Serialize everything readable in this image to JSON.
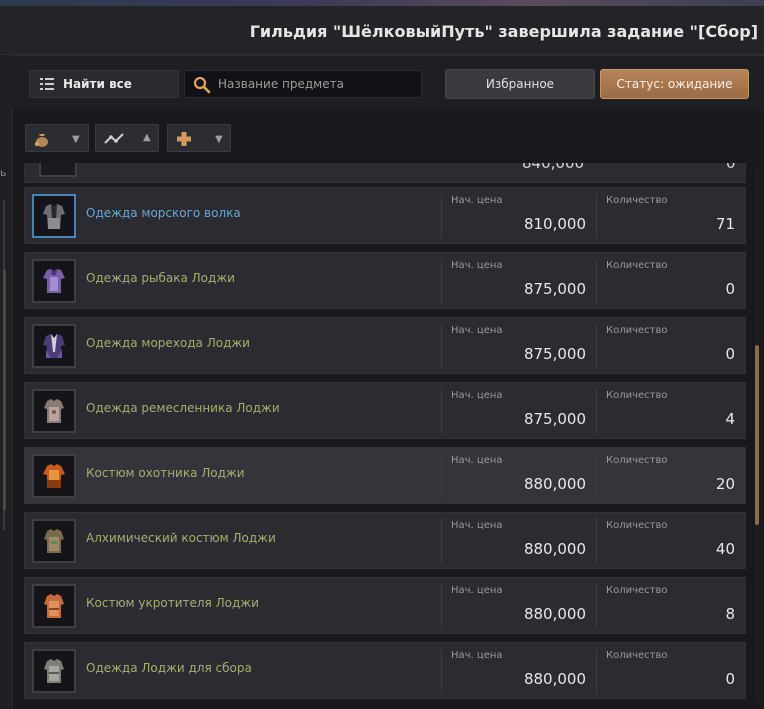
{
  "notice": {
    "text": "Гильдия \"ШёлковыйПуть\" завершила задание \"[Сбор]"
  },
  "toolbar": {
    "find_all_label": "Найти все",
    "search_placeholder": "Название предмета",
    "favorites_label": "Избранное",
    "status_label": "Статус: ожидание"
  },
  "filters": [
    {
      "icon": "bag-icon"
    },
    {
      "icon": "trend-icon"
    },
    {
      "icon": "plus-icon"
    }
  ],
  "list": {
    "partial_row": {
      "price": "840,000",
      "qty": "0"
    },
    "price_label": "Нач. цена",
    "qty_label": "Количество",
    "rows": [
      {
        "name": "Одежда морского волка",
        "price": "810,000",
        "qty": "71",
        "rarity": "blue"
      },
      {
        "name": "Одежда рыбака Лоджи",
        "price": "875,000",
        "qty": "0",
        "rarity": "green"
      },
      {
        "name": "Одежда морехода Лоджи",
        "price": "875,000",
        "qty": "0",
        "rarity": "green"
      },
      {
        "name": "Одежда ремесленника Лоджи",
        "price": "875,000",
        "qty": "4",
        "rarity": "green"
      },
      {
        "name": "Костюм охотника Лоджи",
        "price": "880,000",
        "qty": "20",
        "rarity": "green"
      },
      {
        "name": "Алхимический костюм Лоджи",
        "price": "880,000",
        "qty": "40",
        "rarity": "green"
      },
      {
        "name": "Костюм укротителя Лоджи",
        "price": "880,000",
        "qty": "8",
        "rarity": "green"
      },
      {
        "name": "Одежда Лоджи для сбора",
        "price": "880,000",
        "qty": "0",
        "rarity": "green"
      }
    ]
  },
  "colors": {
    "accent": "#b3825a",
    "item_blue": "#6aa6d4",
    "item_green": "#a8ad6e"
  }
}
